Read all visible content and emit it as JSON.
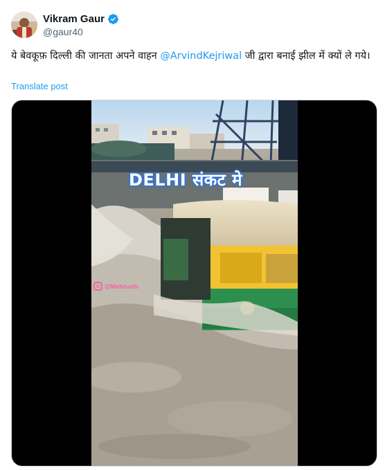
{
  "author": {
    "name": "Vikram Gaur",
    "handle": "@gaur40",
    "verified_icon": "verified-badge-icon",
    "avatar_icon": "avatar-photo"
  },
  "tweet": {
    "text_before": "ये बेवकूफ़ दिल्ली की जानता अपने वाहन ",
    "mention": "@ArvindKejriwal",
    "text_after": " जी द्वारा बनाई झील में क्यों ले गये।",
    "translate_label": "Translate post"
  },
  "media": {
    "overlay_caption": "DELHI संकट मे",
    "watermark_text": "@Mehrushi"
  },
  "colors": {
    "accent": "#1d9bf0",
    "text": "#0f1419",
    "secondary": "#536471",
    "verified": "#1d9bf0"
  }
}
